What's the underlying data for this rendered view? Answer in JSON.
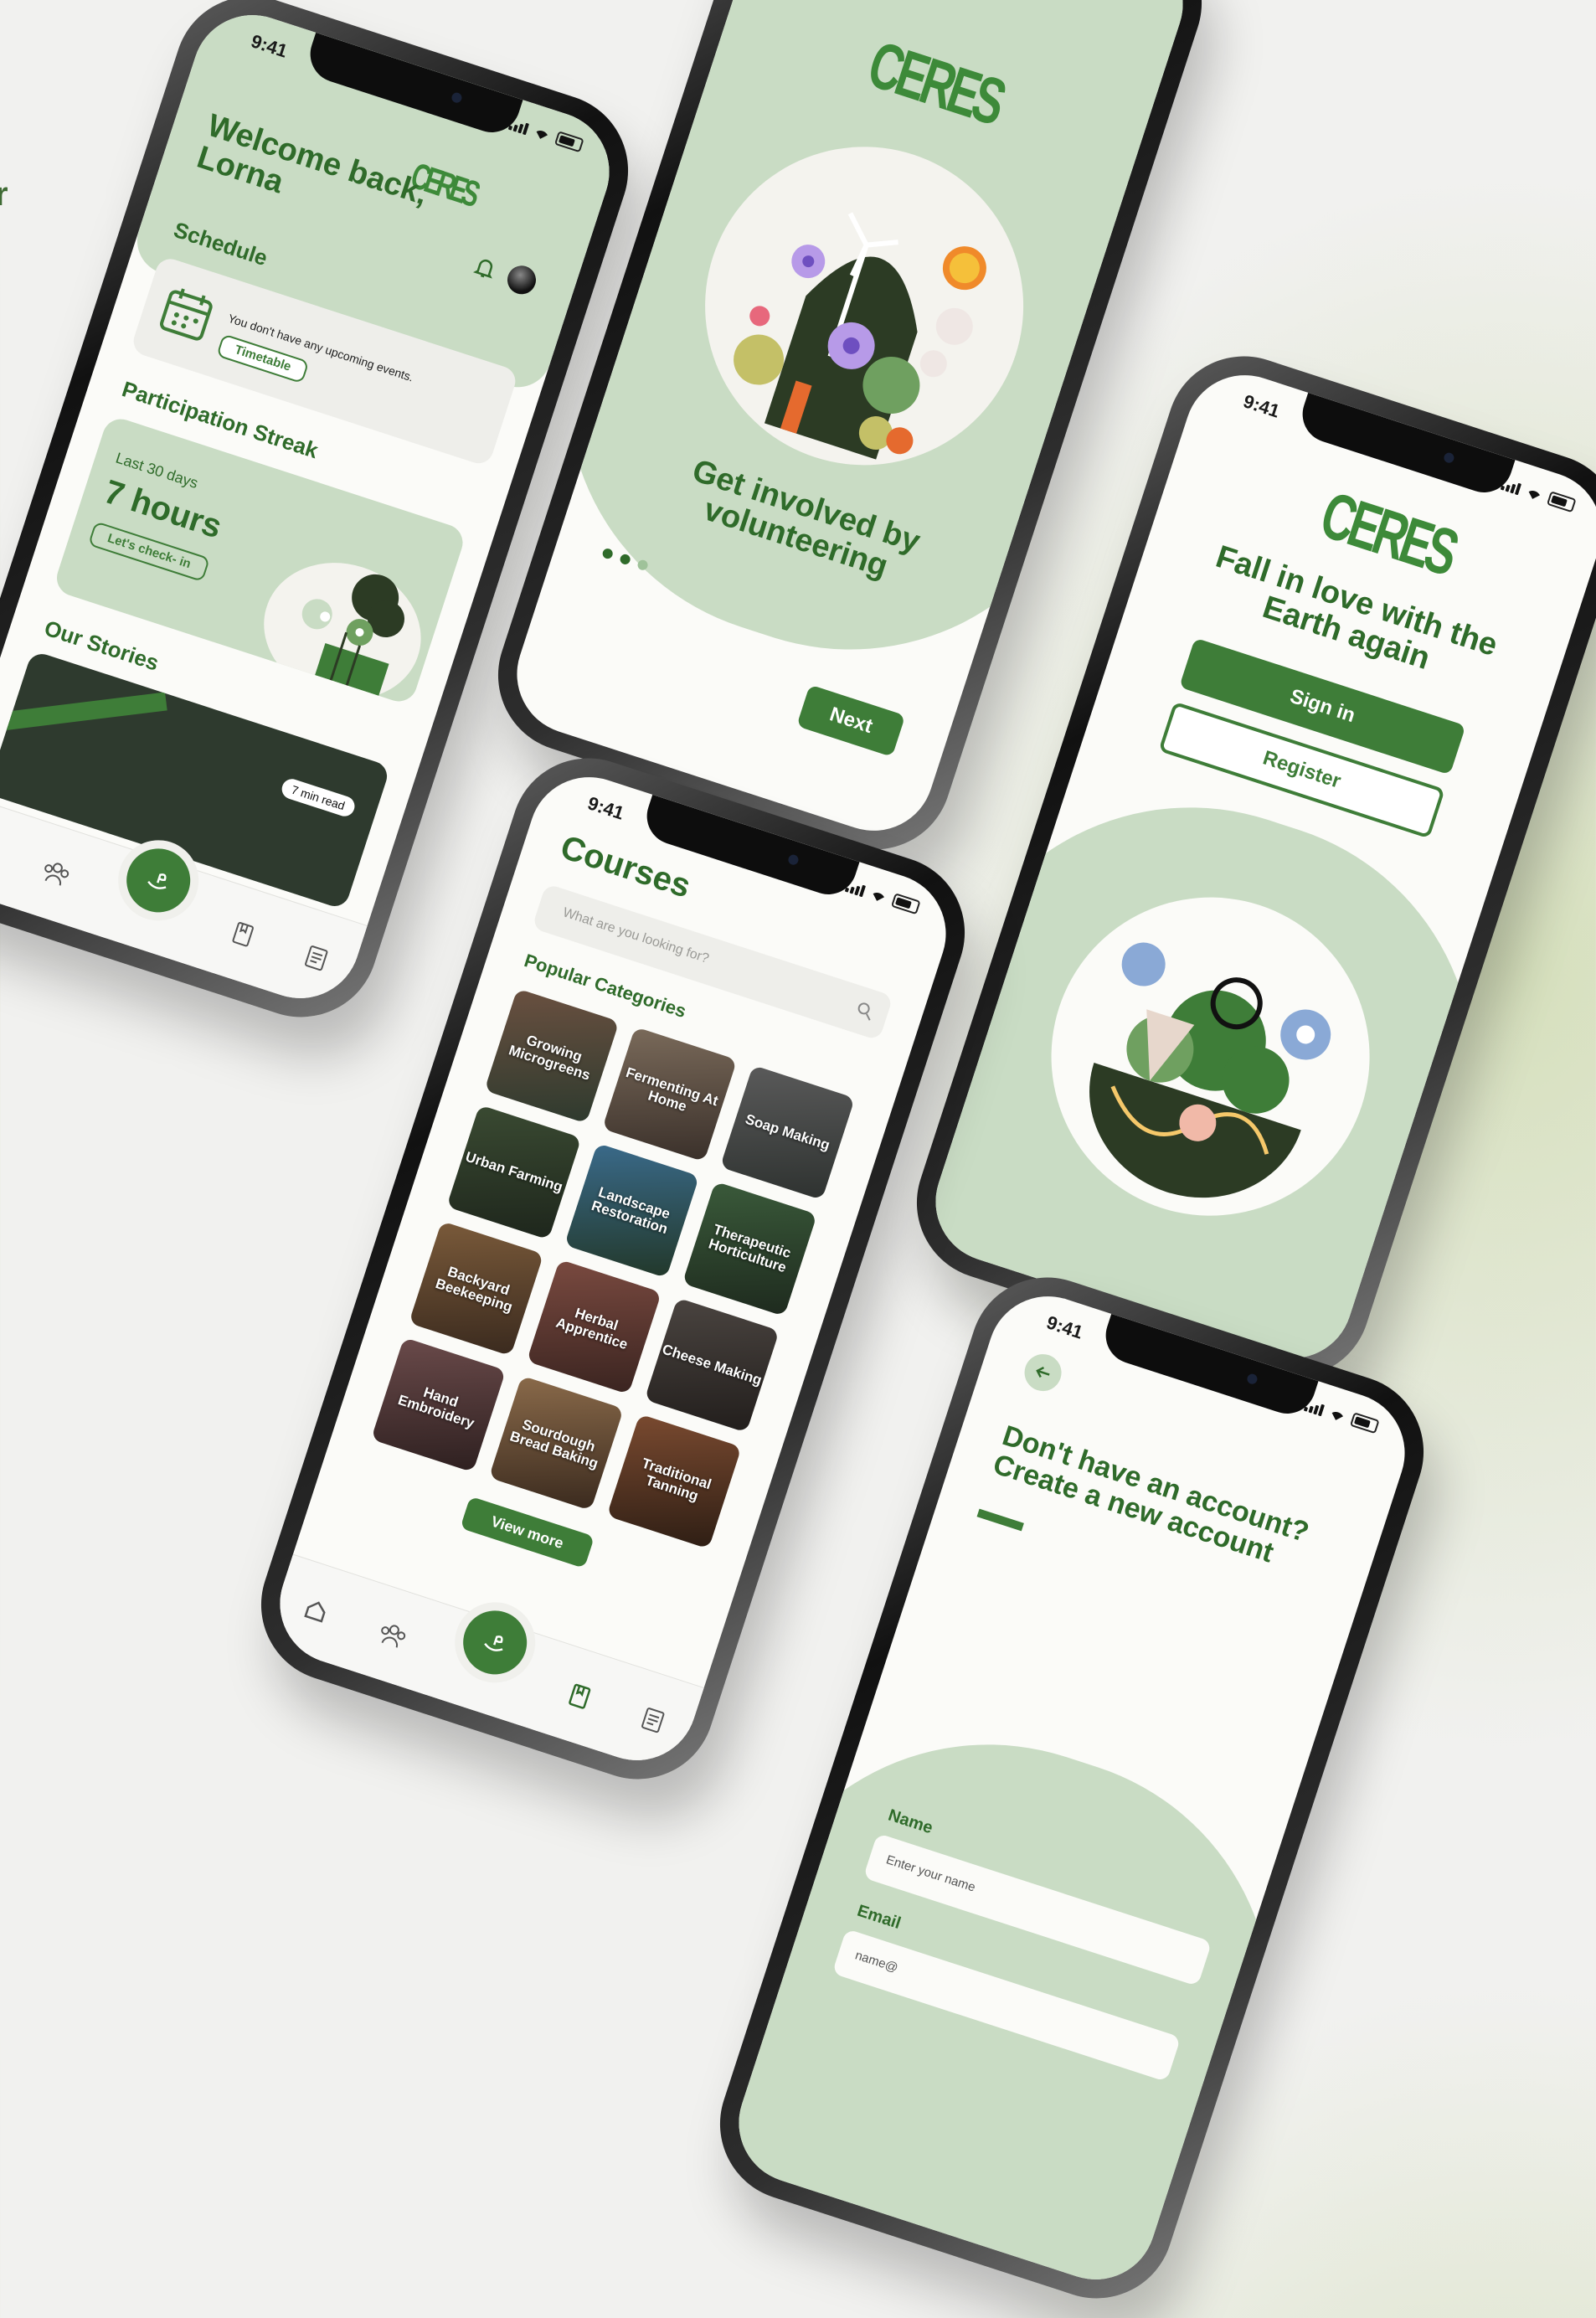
{
  "status": {
    "time": "9:41"
  },
  "home": {
    "greeting": "Welcome back, Lorna",
    "logo": "CERES",
    "schedule_title": "Schedule",
    "schedule_empty": "You don't have any upcoming events.",
    "timetable_label": "Timetable",
    "streak_title": "Participation Streak",
    "streak_period": "Last 30 days",
    "streak_value": "7 hours",
    "checkin_label": "Let's check- in",
    "stories_title": "Our Stories",
    "read_badge": "7 min read",
    "icons": [
      "bell-icon",
      "avatar"
    ]
  },
  "onboarding": {
    "logo": "CERES",
    "headline": "Get involved by volunteering",
    "next_label": "Next",
    "pager": {
      "count": 3,
      "active": 1
    }
  },
  "welcome": {
    "logo": "CERES",
    "headline": "Fall in love with the Earth again",
    "signin_label": "Sign in",
    "register_label": "Register"
  },
  "courses": {
    "title": "Courses",
    "search_placeholder": "What are you looking for?",
    "section_title": "Popular Categories",
    "categories": [
      {
        "label": "Growing Microgreens",
        "color": "#3a4a3a"
      },
      {
        "label": "Fermenting At Home",
        "color": "#5a4a3c"
      },
      {
        "label": "Soap Making",
        "color": "#3d4240"
      },
      {
        "label": "Urban Farming",
        "color": "#34402f"
      },
      {
        "label": "Landscape Restoration",
        "color": "#2c4a5e"
      },
      {
        "label": "Therapeutic Horticulture",
        "color": "#2f4a34"
      },
      {
        "label": "Backyard Beekeeping",
        "color": "#5c3f2a"
      },
      {
        "label": "Herbal Apprentice",
        "color": "#5a3a34"
      },
      {
        "label": "Cheese Making",
        "color": "#3a3430"
      },
      {
        "label": "Hand Embroidery",
        "color": "#4a3a3a"
      },
      {
        "label": "Sourdough Bread Baking",
        "color": "#5a4a3a"
      },
      {
        "label": "Traditional Tanning",
        "color": "#5a3a2a"
      }
    ],
    "view_more_label": "View more"
  },
  "register": {
    "headline": "Don't have an account? Create a new account",
    "name_label": "Name",
    "name_placeholder": "Enter your name",
    "email_label": "Email",
    "email_placeholder": "name@"
  },
  "edge_text": "r",
  "colors": {
    "primary": "#3e7d38",
    "light_green": "#c9dcc4",
    "text_green": "#2f6b2a"
  }
}
